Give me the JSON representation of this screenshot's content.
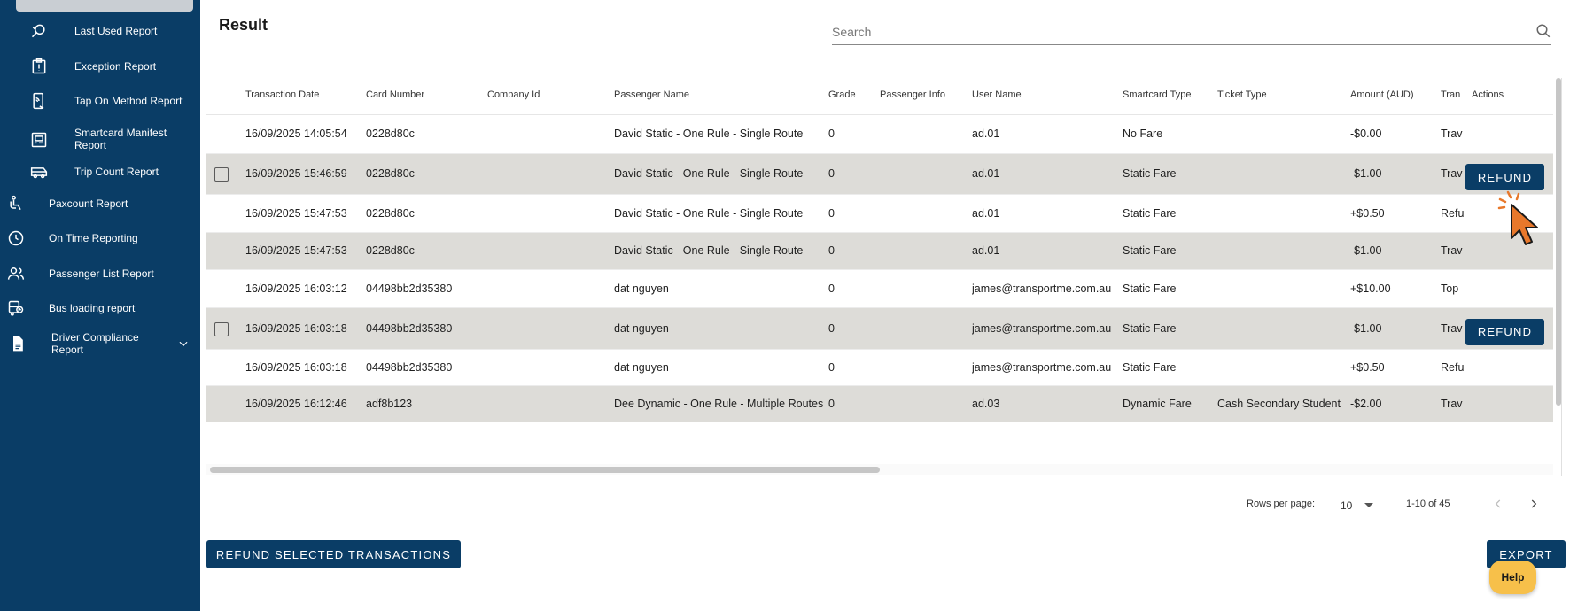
{
  "sidebar": {
    "sub_items": [
      {
        "label": "Last Used Report",
        "icon": "search-history-icon"
      },
      {
        "label": "Exception Report",
        "icon": "exception-icon"
      },
      {
        "label": "Tap On Method Report",
        "icon": "tap-device-icon"
      },
      {
        "label": "Smartcard Manifest Report",
        "icon": "smartcard-icon"
      },
      {
        "label": "Trip Count Report",
        "icon": "bus-icon"
      }
    ],
    "top_items": [
      {
        "label": "Paxcount Report",
        "icon": "passenger-icon"
      },
      {
        "label": "On Time Reporting",
        "icon": "clock-icon"
      },
      {
        "label": "Passenger List Report",
        "icon": "people-icon"
      },
      {
        "label": "Bus loading report",
        "icon": "bus-loading-icon"
      },
      {
        "label": "Driver Compliance Report",
        "icon": "document-icon"
      }
    ]
  },
  "main": {
    "title": "Result",
    "search": {
      "placeholder": "Search",
      "value": ""
    }
  },
  "table": {
    "columns": [
      "Transaction Date",
      "Card Number",
      "Company Id",
      "Passenger Name",
      "Grade",
      "Passenger Info",
      "User Name",
      "Smartcard Type",
      "Ticket Type",
      "Amount (AUD)",
      "Tran",
      "Actions"
    ],
    "rows": [
      {
        "date": "16/09/2025 14:05:54",
        "card": "0228d80c",
        "company": "",
        "passenger": "David Static - One Rule - Single Route",
        "grade": "0",
        "info": "",
        "user": "ad.01",
        "smartcard": "No Fare",
        "ticket": "",
        "amount": "-$0.00",
        "tran": "Trav",
        "checkbox": false,
        "refund": false
      },
      {
        "date": "16/09/2025 15:46:59",
        "card": "0228d80c",
        "company": "",
        "passenger": "David Static - One Rule - Single Route",
        "grade": "0",
        "info": "",
        "user": "ad.01",
        "smartcard": "Static Fare",
        "ticket": "",
        "amount": "-$1.00",
        "tran": "Trav",
        "checkbox": true,
        "refund": true
      },
      {
        "date": "16/09/2025 15:47:53",
        "card": "0228d80c",
        "company": "",
        "passenger": "David Static - One Rule - Single Route",
        "grade": "0",
        "info": "",
        "user": "ad.01",
        "smartcard": "Static Fare",
        "ticket": "",
        "amount": "+$0.50",
        "tran": "Refu",
        "checkbox": false,
        "refund": false
      },
      {
        "date": "16/09/2025 15:47:53",
        "card": "0228d80c",
        "company": "",
        "passenger": "David Static - One Rule - Single Route",
        "grade": "0",
        "info": "",
        "user": "ad.01",
        "smartcard": "Static Fare",
        "ticket": "",
        "amount": "-$1.00",
        "tran": "Trav",
        "checkbox": false,
        "refund": false
      },
      {
        "date": "16/09/2025 16:03:12",
        "card": "04498bb2d35380",
        "company": "",
        "passenger": "dat nguyen",
        "grade": "0",
        "info": "",
        "user": "james@transportme.com.au",
        "smartcard": "Static Fare",
        "ticket": "",
        "amount": "+$10.00",
        "tran": "Top",
        "checkbox": false,
        "refund": false
      },
      {
        "date": "16/09/2025 16:03:18",
        "card": "04498bb2d35380",
        "company": "",
        "passenger": "dat nguyen",
        "grade": "0",
        "info": "",
        "user": "james@transportme.com.au",
        "smartcard": "Static Fare",
        "ticket": "",
        "amount": "-$1.00",
        "tran": "Trav",
        "checkbox": true,
        "refund": true
      },
      {
        "date": "16/09/2025 16:03:18",
        "card": "04498bb2d35380",
        "company": "",
        "passenger": "dat nguyen",
        "grade": "0",
        "info": "",
        "user": "james@transportme.com.au",
        "smartcard": "Static Fare",
        "ticket": "",
        "amount": "+$0.50",
        "tran": "Refu",
        "checkbox": false,
        "refund": false
      },
      {
        "date": "16/09/2025 16:12:46",
        "card": "adf8b123",
        "company": "",
        "passenger": "Dee Dynamic - One Rule - Multiple Routes",
        "grade": "0",
        "info": "",
        "user": "ad.03",
        "smartcard": "Dynamic Fare",
        "ticket": "Cash Secondary Student",
        "amount": "-$2.00",
        "tran": "Trav",
        "checkbox": false,
        "refund": false
      }
    ],
    "refund_label": "REFUND"
  },
  "pagination": {
    "rows_label": "Rows per page:",
    "rows_value": "10",
    "range": "1-10 of 45"
  },
  "footer": {
    "refund_selected_label": "REFUND SELECTED TRANSACTIONS",
    "export_label": "EXPORT",
    "help_label": "Help"
  },
  "colors": {
    "sidebar_bg": "#0a3d66",
    "primary": "#0a3d66",
    "row_alt": "#dddcd8",
    "help": "#f7c04a",
    "cursor": "#e8782b"
  }
}
